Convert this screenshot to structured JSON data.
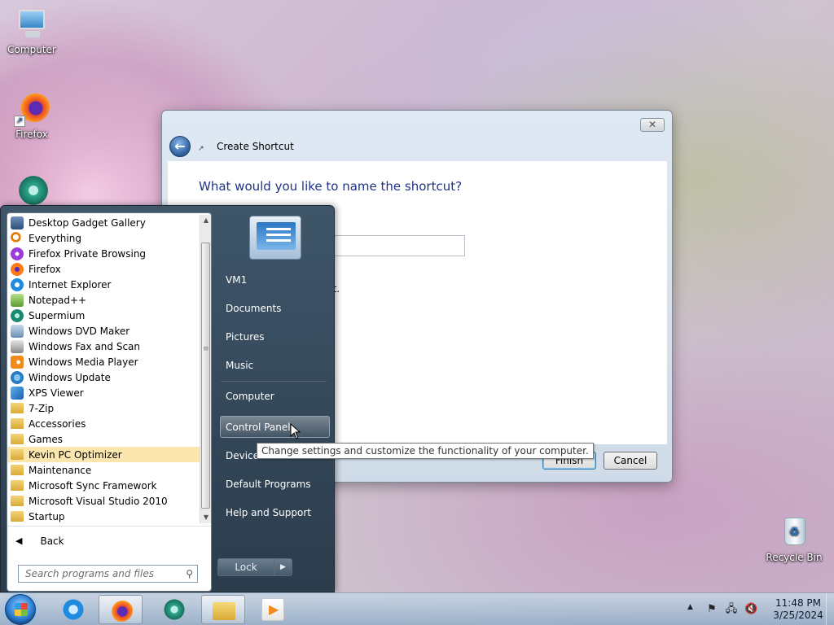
{
  "desktop": {
    "icons": [
      {
        "label": "Computer",
        "icon": "computer-icon"
      },
      {
        "label": "Firefox",
        "icon": "firefox-icon"
      },
      {
        "label": "",
        "icon": "supermium-icon"
      },
      {
        "label": "Recycle Bin",
        "icon": "recycle-bin-icon"
      }
    ]
  },
  "dialog": {
    "title": "Create Shortcut",
    "heading": "What would you like to name the shortcut?",
    "name_value": "",
    "hint_suffix": "ut.",
    "finish_label": "Finish",
    "cancel_label": "Cancel",
    "close_glyph": "✕"
  },
  "start_menu": {
    "programs": [
      {
        "label": "Desktop Gadget Gallery",
        "icon": "gadget-icon"
      },
      {
        "label": "Everything",
        "icon": "everything-search-icon"
      },
      {
        "label": "Firefox Private Browsing",
        "icon": "firefox-private-icon"
      },
      {
        "label": "Firefox",
        "icon": "firefox-icon"
      },
      {
        "label": "Internet Explorer",
        "icon": "internet-explorer-icon"
      },
      {
        "label": "Notepad++",
        "icon": "notepad-plus-plus-icon"
      },
      {
        "label": "Supermium",
        "icon": "supermium-icon"
      },
      {
        "label": "Windows DVD Maker",
        "icon": "dvd-maker-icon"
      },
      {
        "label": "Windows Fax and Scan",
        "icon": "fax-scan-icon"
      },
      {
        "label": "Windows Media Player",
        "icon": "media-player-icon"
      },
      {
        "label": "Windows Update",
        "icon": "windows-update-icon"
      },
      {
        "label": "XPS Viewer",
        "icon": "xps-viewer-icon"
      },
      {
        "label": "7-Zip",
        "icon": "folder-icon"
      },
      {
        "label": "Accessories",
        "icon": "folder-icon"
      },
      {
        "label": "Games",
        "icon": "folder-icon"
      },
      {
        "label": "Kevin PC Optimizer",
        "icon": "folder-icon",
        "selected": true
      },
      {
        "label": "Maintenance",
        "icon": "folder-icon"
      },
      {
        "label": "Microsoft Sync Framework",
        "icon": "folder-icon"
      },
      {
        "label": "Microsoft Visual Studio 2010",
        "icon": "folder-icon"
      },
      {
        "label": "Startup",
        "icon": "folder-icon"
      }
    ],
    "back_label": "Back",
    "search_placeholder": "Search programs and files",
    "right_links": {
      "user": "VM1",
      "documents": "Documents",
      "pictures": "Pictures",
      "music": "Music",
      "computer": "Computer",
      "control_panel": "Control Panel",
      "devices": "Devices",
      "default_programs": "Default Programs",
      "help": "Help and Support"
    },
    "lock_label": "Lock",
    "tooltip": "Change settings and customize the functionality of your computer."
  },
  "taskbar": {
    "pinned": [
      {
        "name": "internet-explorer",
        "active": false
      },
      {
        "name": "firefox",
        "active": true
      },
      {
        "name": "supermium",
        "active": false
      },
      {
        "name": "windows-explorer",
        "active": true
      },
      {
        "name": "windows-media-player",
        "active": false
      }
    ],
    "time": "11:48 PM",
    "date": "3/25/2024"
  }
}
